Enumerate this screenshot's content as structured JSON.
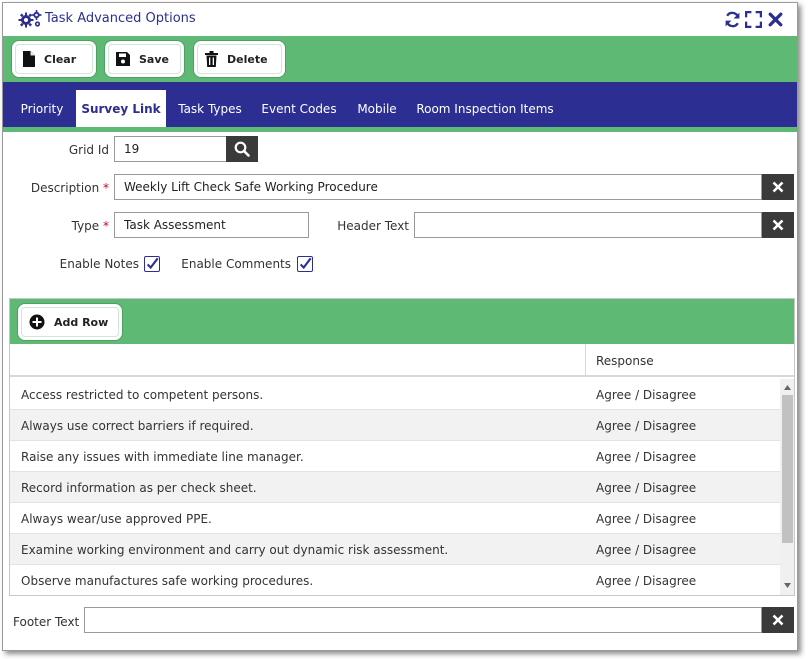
{
  "window": {
    "title": "Task Advanced Options"
  },
  "toolbar": {
    "clear_label": "Clear",
    "save_label": "Save",
    "delete_label": "Delete"
  },
  "tabs": [
    {
      "label": "Priority"
    },
    {
      "label": "Survey Link"
    },
    {
      "label": "Task Types"
    },
    {
      "label": "Event Codes"
    },
    {
      "label": "Mobile"
    },
    {
      "label": "Room Inspection Items"
    }
  ],
  "active_tab": "Survey Link",
  "form": {
    "grid_id_label": "Grid Id",
    "grid_id_value": "19",
    "description_label": "Description",
    "description_value": "Weekly Lift Check Safe Working Procedure",
    "type_label": "Type",
    "type_value": "Task Assessment",
    "header_text_label": "Header Text",
    "header_text_value": "",
    "required_mark": "*",
    "enable_notes_label": "Enable Notes",
    "enable_notes_checked": true,
    "enable_comments_label": "Enable Comments",
    "enable_comments_checked": true
  },
  "grid": {
    "add_row_label": "Add Row",
    "columns": [
      "",
      "Response"
    ],
    "rows": [
      {
        "text": "Access restricted to competent persons.",
        "response": "Agree / Disagree"
      },
      {
        "text": "Always use correct barriers if required.",
        "response": "Agree / Disagree"
      },
      {
        "text": "Raise any issues with immediate line manager.",
        "response": "Agree / Disagree"
      },
      {
        "text": "Record information as per check sheet.",
        "response": "Agree / Disagree"
      },
      {
        "text": "Always wear/use approved PPE.",
        "response": "Agree / Disagree"
      },
      {
        "text": "Examine working environment and carry out dynamic risk assessment.",
        "response": "Agree / Disagree"
      },
      {
        "text": "Observe manufactures safe working procedures.",
        "response": "Agree / Disagree"
      }
    ]
  },
  "footer": {
    "label": "Footer Text",
    "value": ""
  },
  "colors": {
    "brand_green": "#5db974",
    "brand_navy": "#2c2f91",
    "dark_button": "#3a3a3a",
    "required": "#d0021b"
  }
}
